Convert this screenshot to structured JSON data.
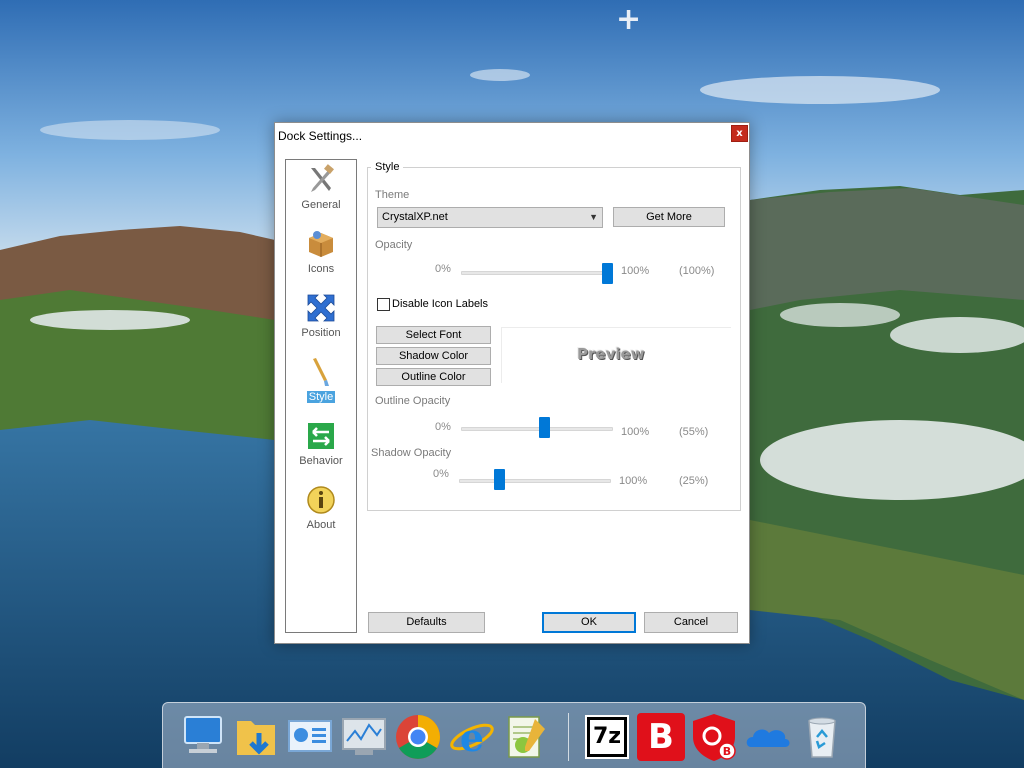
{
  "desktop": {
    "add_icon": "plus-icon"
  },
  "dialog": {
    "title": "Dock Settings...",
    "close_glyph": "x",
    "sidebar": [
      {
        "label": "General",
        "icon": "tools-icon"
      },
      {
        "label": "Icons",
        "icon": "box-icon"
      },
      {
        "label": "Position",
        "icon": "arrows-icon"
      },
      {
        "label": "Style",
        "icon": "brush-icon",
        "active": true
      },
      {
        "label": "Behavior",
        "icon": "arrow-switch-icon"
      },
      {
        "label": "About",
        "icon": "info-icon"
      }
    ],
    "style": {
      "group_label": "Style",
      "theme_label": "Theme",
      "theme_value": "CrystalXP.net",
      "get_more": "Get More",
      "opacity_label": "Opacity",
      "opacity_min": "0%",
      "opacity_max": "100%",
      "opacity_value": "(100%)",
      "opacity_level": 1.0,
      "disable_labels": "Disable Icon Labels",
      "disable_labels_checked": false,
      "select_font": "Select Font",
      "shadow_color": "Shadow Color",
      "outline_color": "Outline Color",
      "preview": "Preview",
      "outline_opacity_label": "Outline Opacity",
      "outline_min": "0%",
      "outline_max": "100%",
      "outline_value": "(55%)",
      "outline_level": 0.55,
      "shadow_opacity_label": "Shadow Opacity",
      "shadow_min": "0%",
      "shadow_max": "100%",
      "shadow_value": "(25%)",
      "shadow_level": 0.25
    },
    "buttons": {
      "defaults": "Defaults",
      "ok": "OK",
      "cancel": "Cancel"
    }
  },
  "dock": {
    "items": [
      "computer-icon",
      "downloads-folder-icon",
      "control-panel-icon",
      "resource-monitor-icon",
      "chrome-icon",
      "internet-explorer-icon",
      "notepad-plus-plus-icon",
      "7zip-icon",
      "bitdefender-icon",
      "bitdefender-vpn-icon",
      "onedrive-icon",
      "recycle-bin-icon"
    ],
    "sevenzip_label": "7z",
    "bitdefender_label": "B"
  },
  "colors": {
    "accent": "#0078d7",
    "close": "#c42b1c",
    "active_item": "#4aa3df"
  }
}
